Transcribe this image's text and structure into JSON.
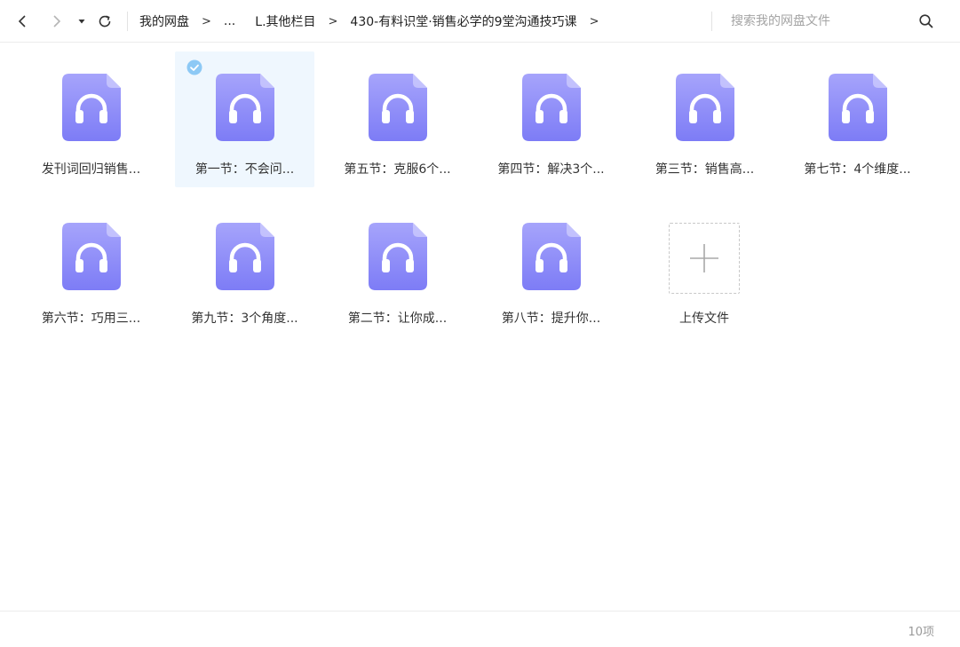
{
  "toolbar": {
    "back_icon": "chevron-left-icon",
    "forward_icon": "chevron-right-icon",
    "history_icon": "caret-down-icon",
    "refresh_icon": "refresh-icon",
    "breadcrumb": [
      {
        "label": "我的网盘"
      },
      {
        "label": "..."
      },
      {
        "label": "L.其他栏目"
      },
      {
        "label": "430-有料识堂·销售必学的9堂沟通技巧课"
      }
    ],
    "crumb_separator": ">",
    "search_placeholder": "搜索我的网盘文件",
    "search_value": "",
    "search_icon": "search-icon"
  },
  "files": [
    {
      "name": "发刊词回归销售...",
      "type": "audio",
      "selected": false
    },
    {
      "name": "第一节：不会问...",
      "type": "audio",
      "selected": true
    },
    {
      "name": "第五节：克服6个...",
      "type": "audio",
      "selected": false
    },
    {
      "name": "第四节：解决3个...",
      "type": "audio",
      "selected": false
    },
    {
      "name": "第三节：销售高...",
      "type": "audio",
      "selected": false
    },
    {
      "name": "第七节：4个维度...",
      "type": "audio",
      "selected": false
    },
    {
      "name": "第六节：巧用三...",
      "type": "audio",
      "selected": false
    },
    {
      "name": "第九节：3个角度...",
      "type": "audio",
      "selected": false
    },
    {
      "name": "第二节：让你成...",
      "type": "audio",
      "selected": false
    },
    {
      "name": "第八节：提升你...",
      "type": "audio",
      "selected": false
    }
  ],
  "upload": {
    "label": "上传文件",
    "icon": "plus-icon"
  },
  "status": {
    "count_label": "10项"
  },
  "colors": {
    "icon_top": "#a6a4fb",
    "icon_bottom": "#7d7cf6",
    "selection_bg": "#eff7fe",
    "check": "#8dc9f5"
  }
}
